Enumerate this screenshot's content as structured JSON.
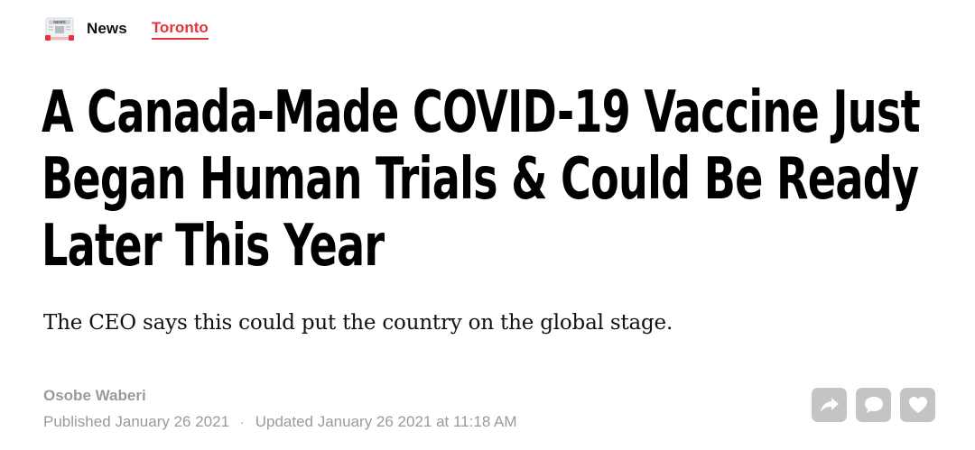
{
  "header": {
    "section_label": "News",
    "category_link": "Toronto",
    "icon_badge_text": "NEWS"
  },
  "article": {
    "headline": "A Canada-Made COVID-19 Vaccine Just Began Human Trials & Could Be Ready Later This Year",
    "subtitle": "The CEO says this could put the country on the global stage.",
    "author": "Osobe Waberi",
    "published": "Published January 26 2021",
    "separator": "·",
    "updated": "Updated January 26 2021 at 11:18 AM"
  },
  "actions": {
    "share": "share-icon",
    "comment": "comment-icon",
    "like": "heart-icon"
  },
  "colors": {
    "accent": "#e8323c",
    "muted_text": "#9a9a9a",
    "action_bg": "#c4c4c4"
  }
}
